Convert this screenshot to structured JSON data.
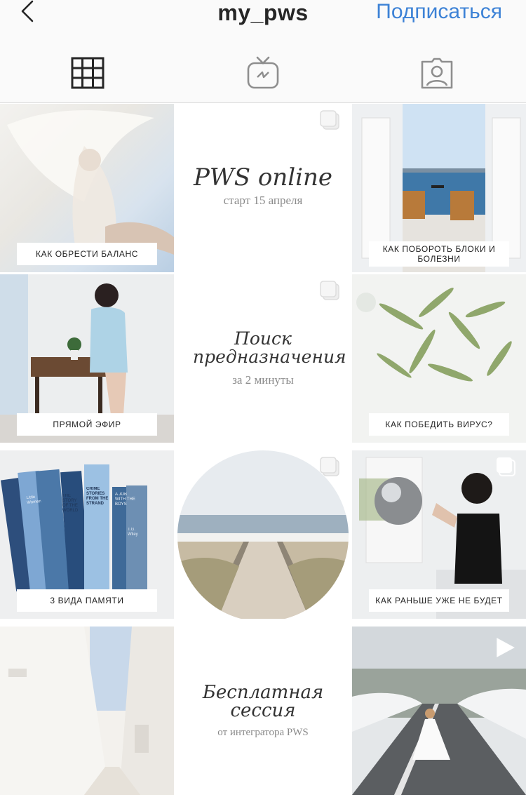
{
  "header": {
    "username": "my_pws",
    "subscribe_label": "Подписаться"
  },
  "tabs": [
    {
      "name": "grid",
      "icon": "grid-icon",
      "active": true
    },
    {
      "name": "igtv",
      "icon": "igtv-icon"
    },
    {
      "name": "tagged",
      "icon": "tagged-person-icon"
    }
  ],
  "posts": [
    {
      "caption": "КАК ОБРЕСТИ БАЛАНС",
      "scene": "woman with flowing white fabric"
    },
    {
      "title": "PWS online",
      "subtitle": "старт 15 апреля",
      "multi": true
    },
    {
      "caption": "КАК ПОБОРОТЬ БЛОКИ И БОЛЕЗНИ",
      "scene": "balcony with chairs overlooking sea"
    },
    {
      "caption": "ПРЯМОЙ ЭФИР",
      "scene": "woman sitting by wooden table"
    },
    {
      "title": "Поиск предназначения",
      "subtitle": "за 2 минуты",
      "multi": true
    },
    {
      "caption": "КАК ПОБЕДИТЬ ВИРУС?",
      "scene": "olive branch"
    },
    {
      "caption": "3 ВИДА ПАМЯТИ",
      "scene": "stack of blue books",
      "book_titles": [
        "Little Women",
        "THE STORY OF THE WORLD",
        "CRIME STORIES FROM THE STRAND",
        "A JOB WITH THE BOYS",
        "T.G. Wiley"
      ]
    },
    {
      "scene": "boardwalk to beach in circle",
      "multi": true
    },
    {
      "caption": "КАК РАНЬШЕ УЖЕ НЕ БУДЕТ",
      "scene": "woman holding chrome ball",
      "multi": true
    },
    {
      "scene": "white narrow street"
    },
    {
      "title": "Бесплатная сессия",
      "subtitle": "от интегратора PWS"
    },
    {
      "scene": "woman in white dress on road",
      "video": true
    }
  ],
  "colors": {
    "accent": "#3d82d6",
    "text": "#262626",
    "divider": "#dbdbdb"
  }
}
